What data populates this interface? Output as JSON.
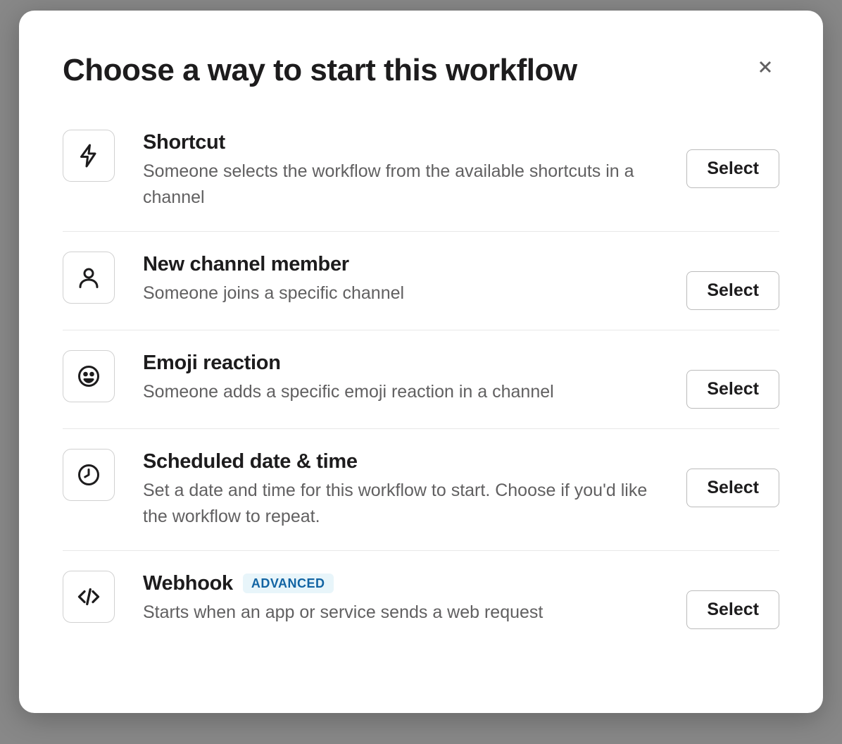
{
  "modal": {
    "title": "Choose a way to start this workflow",
    "select_label": "Select",
    "triggers": [
      {
        "icon": "lightning",
        "title": "Shortcut",
        "desc": "Someone selects the workflow from the available shortcuts in a channel"
      },
      {
        "icon": "person",
        "title": "New channel member",
        "desc": "Someone joins a specific channel"
      },
      {
        "icon": "emoji",
        "title": "Emoji reaction",
        "desc": "Someone adds a specific emoji reaction in a channel"
      },
      {
        "icon": "clock",
        "title": "Scheduled date & time",
        "desc": "Set a date and time for this workflow to start. Choose if you'd like the workflow to repeat."
      },
      {
        "icon": "code",
        "title": "Webhook",
        "badge": "ADVANCED",
        "desc": "Starts when an app or service sends a web request"
      }
    ]
  }
}
